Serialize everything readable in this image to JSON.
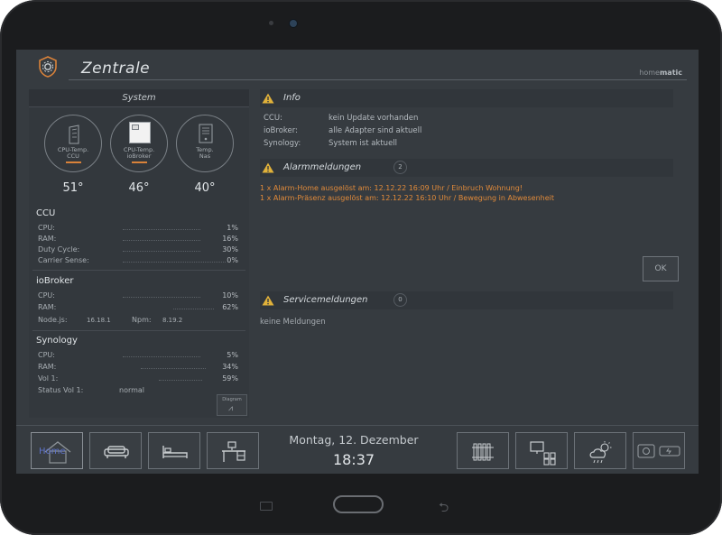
{
  "header": {
    "title": "Zentrale",
    "brand_prefix": "home",
    "brand_suffix": "matic"
  },
  "system": {
    "title": "System",
    "gauges": [
      {
        "line1": "CPU-Temp.",
        "line2": "CCU",
        "value": "51°"
      },
      {
        "line1": "CPU-Temp.",
        "line2": "ioBroker",
        "value": "46°"
      },
      {
        "line1": "Temp.",
        "line2": "Nas",
        "value": "40°"
      }
    ],
    "ccu": {
      "title": "CCU",
      "rows": [
        {
          "label": "CPU:",
          "value": "1%"
        },
        {
          "label": "RAM:",
          "value": "16%"
        },
        {
          "label": "Duty Cycle:",
          "value": "30%"
        },
        {
          "label": "Carrier Sense:",
          "value": "0%"
        }
      ]
    },
    "iobroker": {
      "title": "ioBroker",
      "rows": [
        {
          "label": "CPU:",
          "value": "10%"
        },
        {
          "label": "RAM:",
          "value": "62%"
        }
      ],
      "nodejs_label": "Node.js:",
      "nodejs_value": "16.18.1",
      "npm_label": "Npm:",
      "npm_value": "8.19.2"
    },
    "synology": {
      "title": "Synology",
      "rows": [
        {
          "label": "CPU:",
          "value": "5%"
        },
        {
          "label": "RAM:",
          "value": "34%"
        },
        {
          "label": "Vol 1:",
          "value": "59%"
        }
      ],
      "status_label": "Status Vol 1:",
      "status_value": "normal"
    },
    "diagram_label": "Diagram"
  },
  "info": {
    "title": "Info",
    "rows": [
      {
        "key": "CCU:",
        "value": "kein Update vorhanden"
      },
      {
        "key": "ioBroker:",
        "value": "alle Adapter sind aktuell"
      },
      {
        "key": "Synology:",
        "value": "System ist aktuell"
      }
    ]
  },
  "alarms": {
    "title": "Alarmmeldungen",
    "count": "2",
    "items": [
      "1 x Alarm-Home ausgelöst am: 12.12.22 16:09 Uhr / Einbruch Wohnung!",
      "1 x Alarm-Präsenz ausgelöst am: 12.12.22 16:10 Uhr / Bewegung in Abwesenheit"
    ],
    "ok_label": "OK"
  },
  "service": {
    "title": "Servicemeldungen",
    "count": "0",
    "empty_text": "keine Meldungen"
  },
  "footer": {
    "home_label": "Home",
    "date": "Montag, 12. Dezember",
    "time": "18:37"
  },
  "colors": {
    "alarm": "#e08a3a",
    "warning": "#e0b13a",
    "accent": "#d9823a",
    "background": "#363b40"
  }
}
